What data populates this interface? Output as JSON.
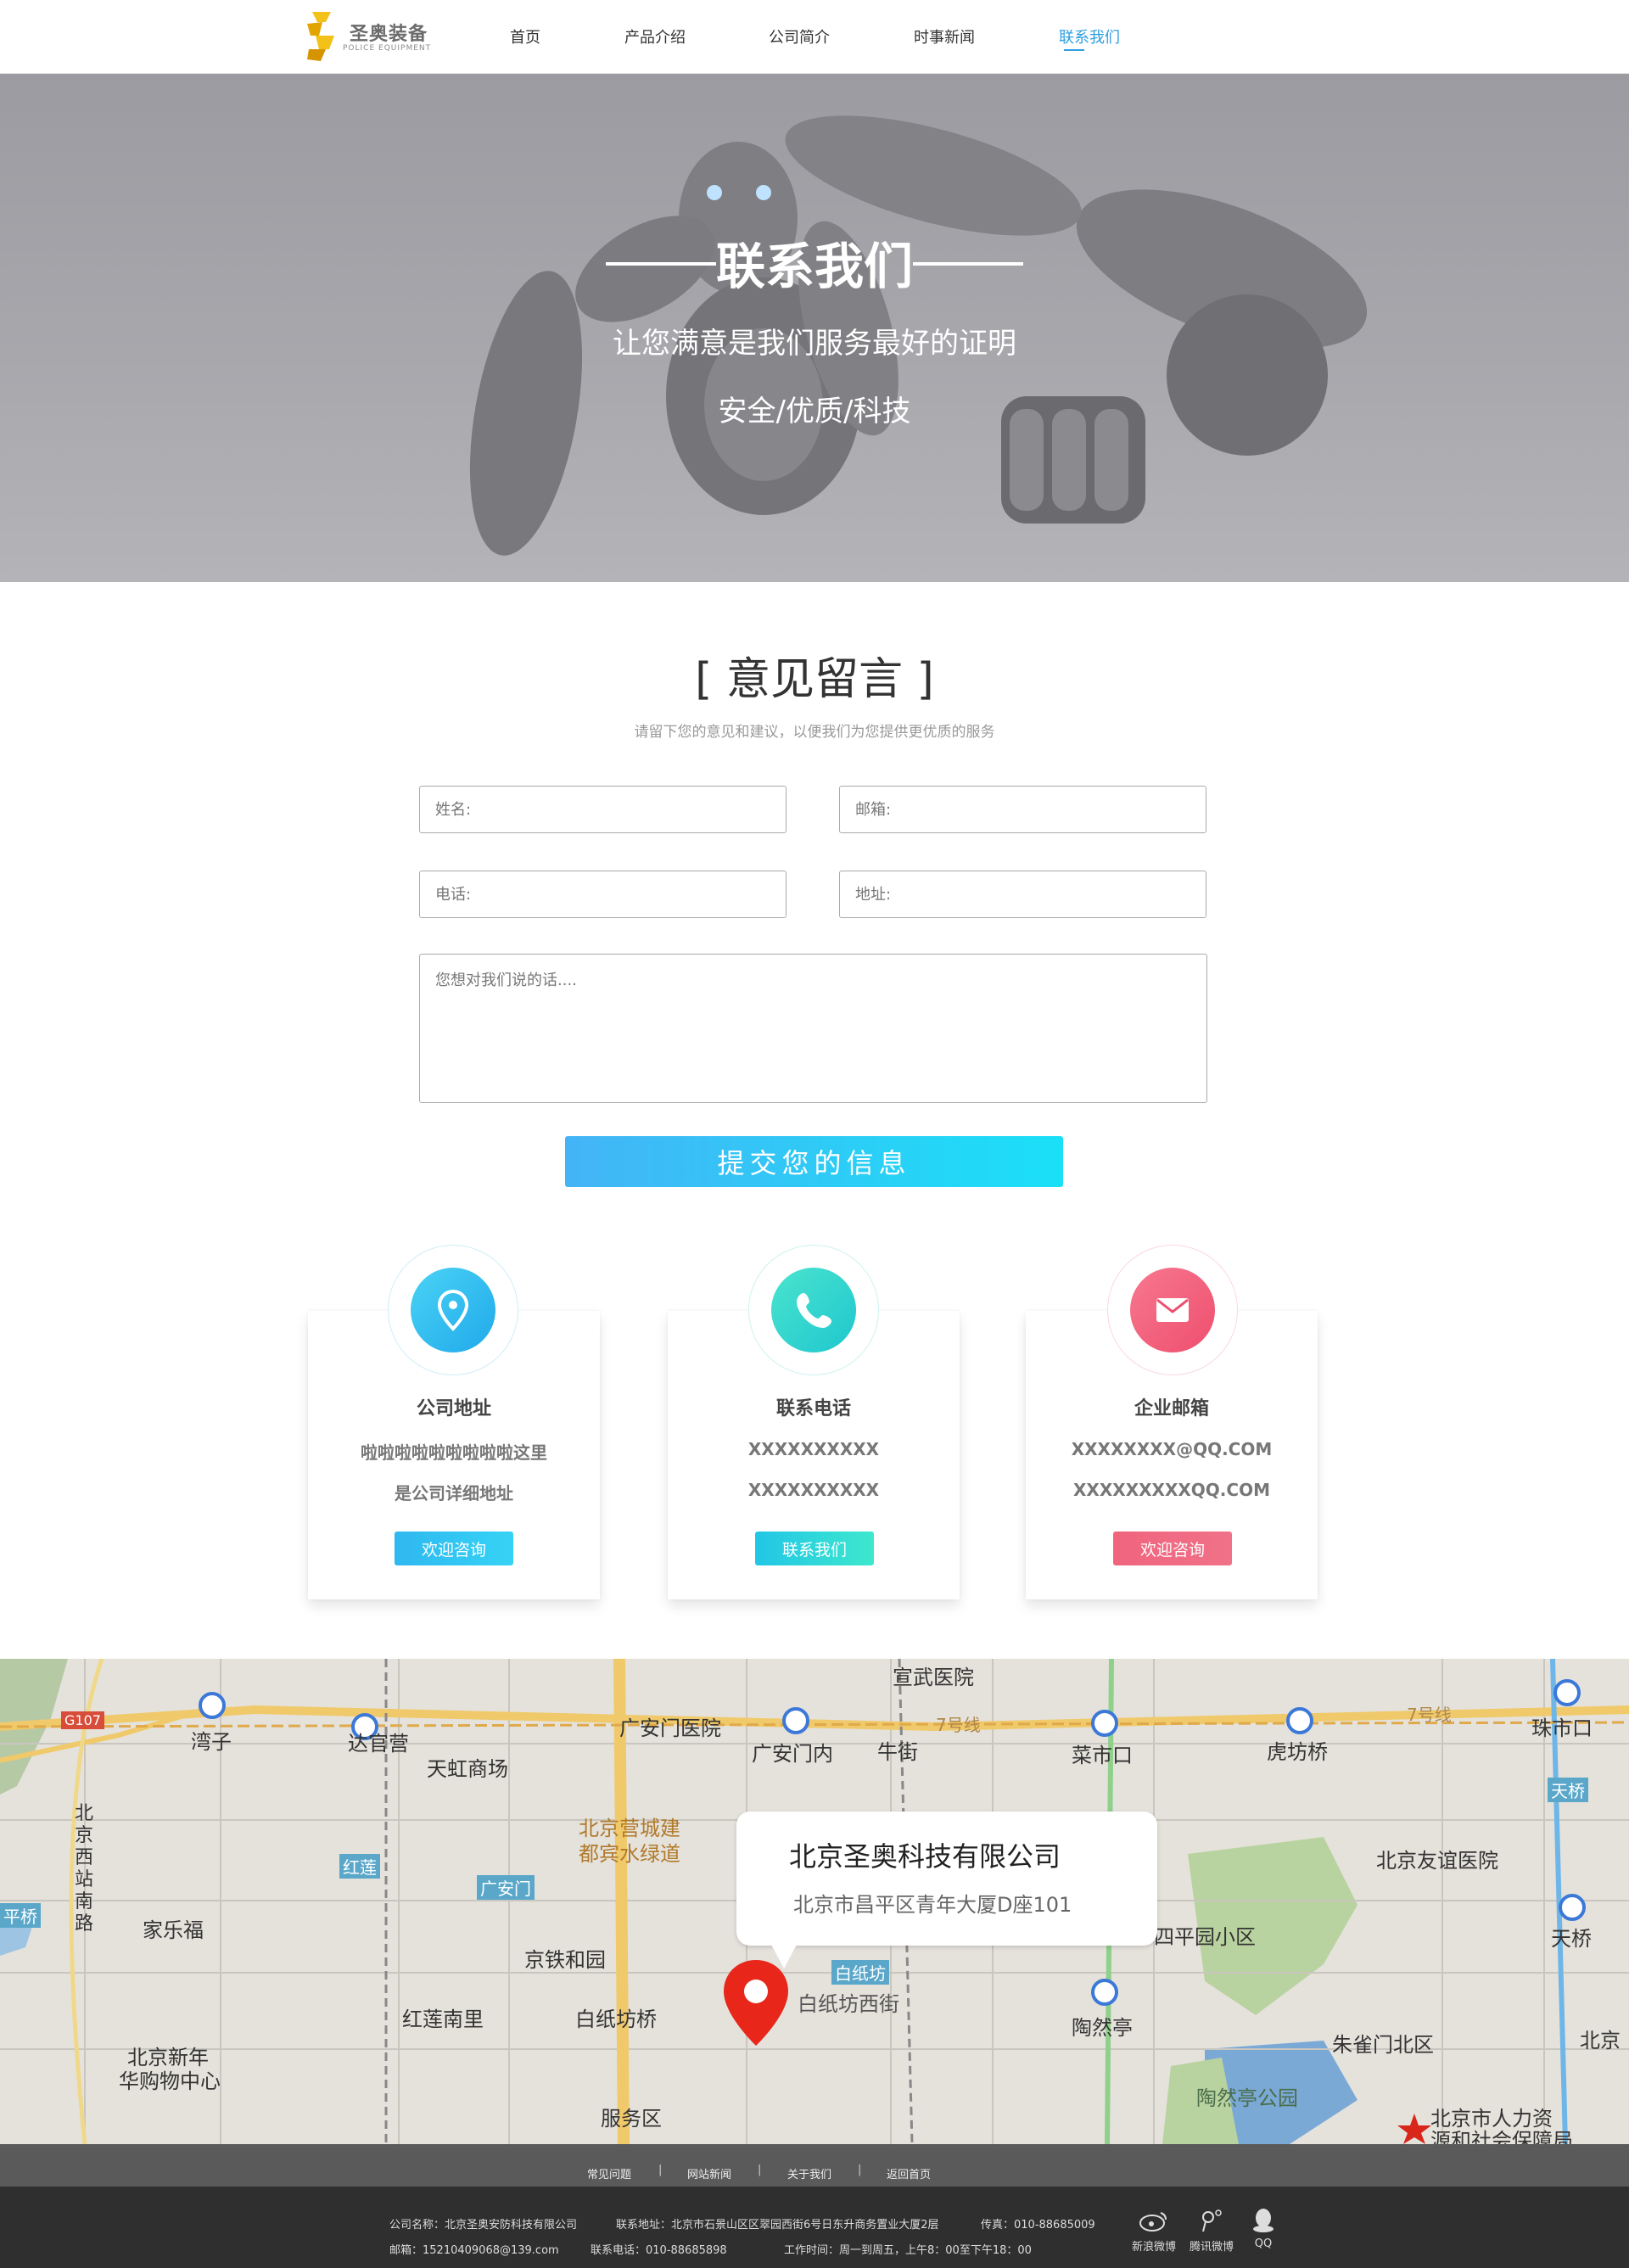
{
  "nav": {
    "logo_cn": "圣奥装备",
    "logo_en": "POLICE EQUIPMENT",
    "items": [
      "首页",
      "产品介绍",
      "公司简介",
      "时事新闻",
      "联系我们"
    ],
    "active_index": 4
  },
  "hero": {
    "title": "联系我们",
    "subtitle": "让您满意是我们服务最好的证明",
    "tagline": "安全/优质/科技"
  },
  "feedback": {
    "title": "[  意见留言 ]",
    "description": "请留下您的意见和建议，以便我们为您提供更优质的服务",
    "name_placeholder": "姓名:",
    "email_placeholder": "邮箱:",
    "phone_placeholder": "电话:",
    "address_placeholder": "地址:",
    "message_placeholder": "您想对我们说的话....",
    "submit_label": "提交您的信息"
  },
  "cards": [
    {
      "title": "公司地址",
      "line1": "啦啦啦啦啦啦啦啦啦这里",
      "line2": "是公司详细地址",
      "button": "欢迎咨询",
      "icon": "location-pin-icon",
      "color": "#34c1f0"
    },
    {
      "title": "联系电话",
      "line1": "XXXXXXXXXX",
      "line2": "XXXXXXXXXX",
      "button": "联系我们",
      "icon": "phone-icon",
      "color": "#36d9c7"
    },
    {
      "title": "企业邮箱",
      "line1": "XXXXXXXX@QQ.COM",
      "line2": "XXXXXXXXXQQ.COM",
      "button": "欢迎咨询",
      "icon": "mail-icon",
      "color": "#f05a78"
    }
  ],
  "map": {
    "company_name": "北京圣奥科技有限公司",
    "company_address": "北京市昌平区青年大厦D座101",
    "labels": {
      "l1": "宣武医院",
      "l2": "湾子",
      "l3": "达官营",
      "l4": "天虹商场",
      "l5": "广安门医院",
      "l6": "广安门内",
      "l7": "牛街",
      "l8": "菜市口",
      "l9": "虎坊桥",
      "l10": "珠市口",
      "l11": "北京营城建",
      "l12": "都宾水绿道",
      "l13": "家乐福",
      "l14": "京铁和园",
      "l15": "红莲南里",
      "l16": "白纸坊桥",
      "l17": "北京新年",
      "l18": "华购物中心",
      "l19": "服务区",
      "l20": "白纸坊西街",
      "l21": "陶然亭",
      "l22": "四平园小区",
      "l23": "北京友谊医院",
      "l24": "天桥",
      "l25": "朱雀门北区",
      "l26": "陶然亭公园",
      "l27": "北京市人力资",
      "l28": "源和社会保障局",
      "l29": "北京西站南路",
      "l30": "G107",
      "l31": "7号线",
      "l32": "7号线",
      "l33": "红莲",
      "l34": "广安门",
      "l35": "白纸坊",
      "l36": "天桥",
      "l37": "平桥",
      "l38": "北京"
    }
  },
  "footer": {
    "links": [
      "常见问题",
      "网站新闻",
      "关于我们",
      "返回首页"
    ],
    "company_label": "公司名称：北京圣奥安防科技有限公司",
    "address_label": "联系地址：北京市石景山区区翠园西街6号日东升商务置业大厦2层",
    "fax_label": "传真：010-88685009",
    "email_label": "邮箱：15210409068@139.com",
    "phone_label": "联系电话：010-88685898",
    "hours_label": "工作时间：周一到周五，上午8：00至下午18：00",
    "social": [
      "新浪微博",
      "腾讯微博",
      "QQ"
    ]
  }
}
